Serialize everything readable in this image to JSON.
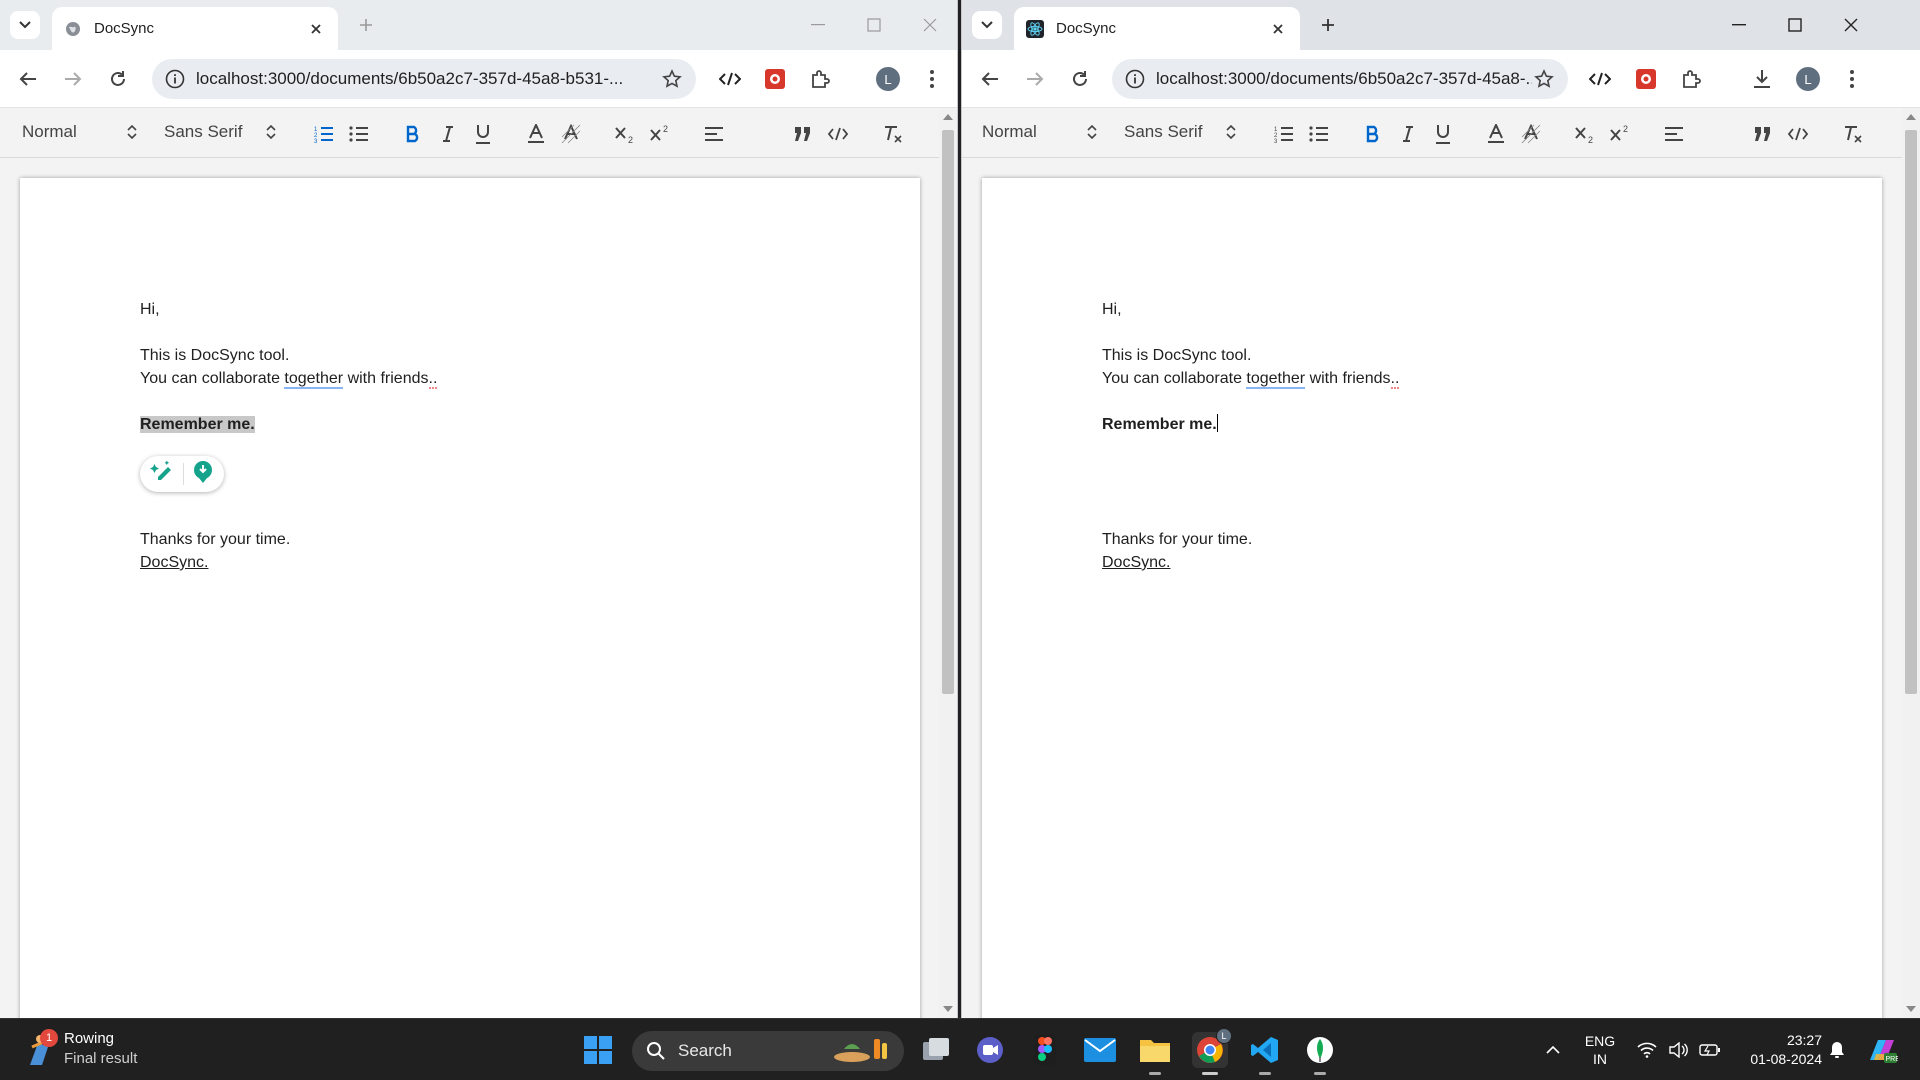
{
  "left_window": {
    "tab_title": "DocSync",
    "url": "localhost:3000/documents/6b50a2c7-357d-45a8-b531-...",
    "avatar_letter": "L",
    "editor": {
      "heading_select": "Normal",
      "font_select": "Sans Serif"
    },
    "document": {
      "greeting": "Hi,",
      "line1": "This is DocSync tool.",
      "line2_a": "You can collaborate ",
      "line2_b": "together",
      "line2_c": " with friends",
      "line2_d": "..",
      "bold_line": "Remember me.",
      "closing": "Thanks for your time.",
      "signature": "DocSync."
    }
  },
  "right_window": {
    "tab_title": "DocSync",
    "url": "localhost:3000/documents/6b50a2c7-357d-45a8-...",
    "avatar_letter": "L",
    "editor": {
      "heading_select": "Normal",
      "font_select": "Sans Serif"
    },
    "document": {
      "greeting": "Hi,",
      "line1": "This is DocSync tool.",
      "line2_a": "You can collaborate ",
      "line2_b": "together",
      "line2_c": " with friends",
      "line2_d": "..",
      "bold_line": "Remember me.",
      "closing": "Thanks for your time.",
      "signature": "DocSync."
    }
  },
  "taskbar": {
    "weather_badge": "1",
    "weather_title": "Rowing",
    "weather_subtitle": "Final result",
    "search_label": "Search",
    "lang_top": "ENG",
    "lang_bottom": "IN",
    "time": "23:27",
    "date": "01-08-2024",
    "chrome_badge": "L"
  },
  "colors": {
    "accent_blue": "#0066cc",
    "taskbar_bg": "#202020",
    "editor_toolbar_bg": "#f3f3f3",
    "grammar_green": "#15a38b"
  }
}
